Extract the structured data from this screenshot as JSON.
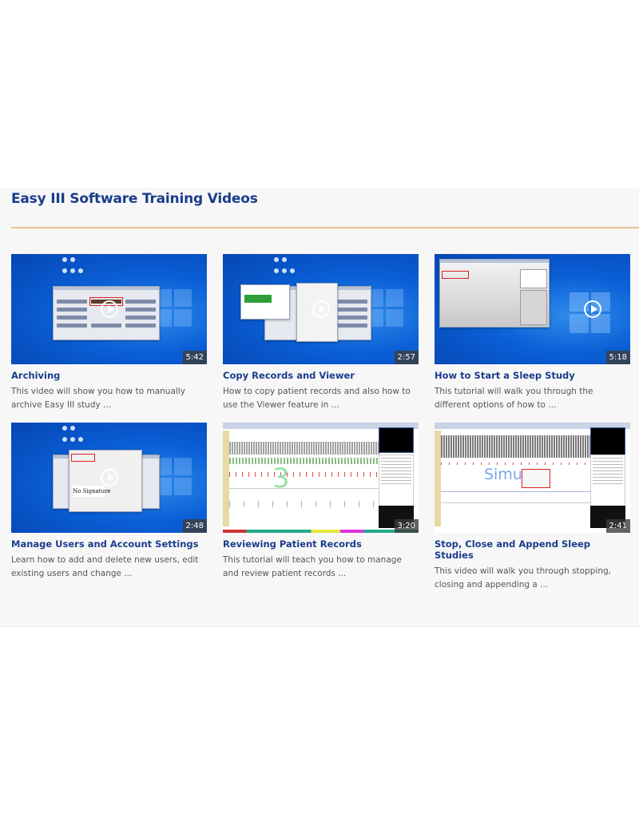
{
  "section": {
    "title": "Easy III Software Training Videos",
    "accent_color": "#e6c48d",
    "title_color": "#1b3c8c"
  },
  "videos": [
    {
      "title": "Archiving",
      "description": "This video will show you how to manually archive Easy III study ...",
      "duration": "5:42",
      "thumbnail": "windows-desktop-archiving"
    },
    {
      "title": "Copy Records and Viewer",
      "description": "How to copy patient records and also how to use the Viewer feature in ...",
      "duration": "2:57",
      "thumbnail": "windows-desktop-copy-dialog"
    },
    {
      "title": "How to Start a Sleep Study",
      "description": "This tutorial will walk you through the different options of how to ...",
      "duration": "5:18",
      "thumbnail": "windows-desktop-start-study"
    },
    {
      "title": "Manage Users and Account Settings",
      "description": "Learn how to add and delete new users, edit existing users and change ...",
      "duration": "2:48",
      "thumbnail": "windows-desktop-user-dialog",
      "thumbnail_text": "No Signature"
    },
    {
      "title": "Reviewing Patient Records",
      "description": "This tutorial will teach you how to manage and review patient records ...",
      "duration": "3:20",
      "thumbnail": "eeg-review-screen",
      "thumbnail_text": "3"
    },
    {
      "title": "Stop, Close and Append Sleep Studies",
      "description": "This video will walk you through stopping, closing and appending a ...",
      "duration": "2:41",
      "thumbnail": "eeg-recording-screen",
      "thumbnail_text": "Simu"
    }
  ]
}
